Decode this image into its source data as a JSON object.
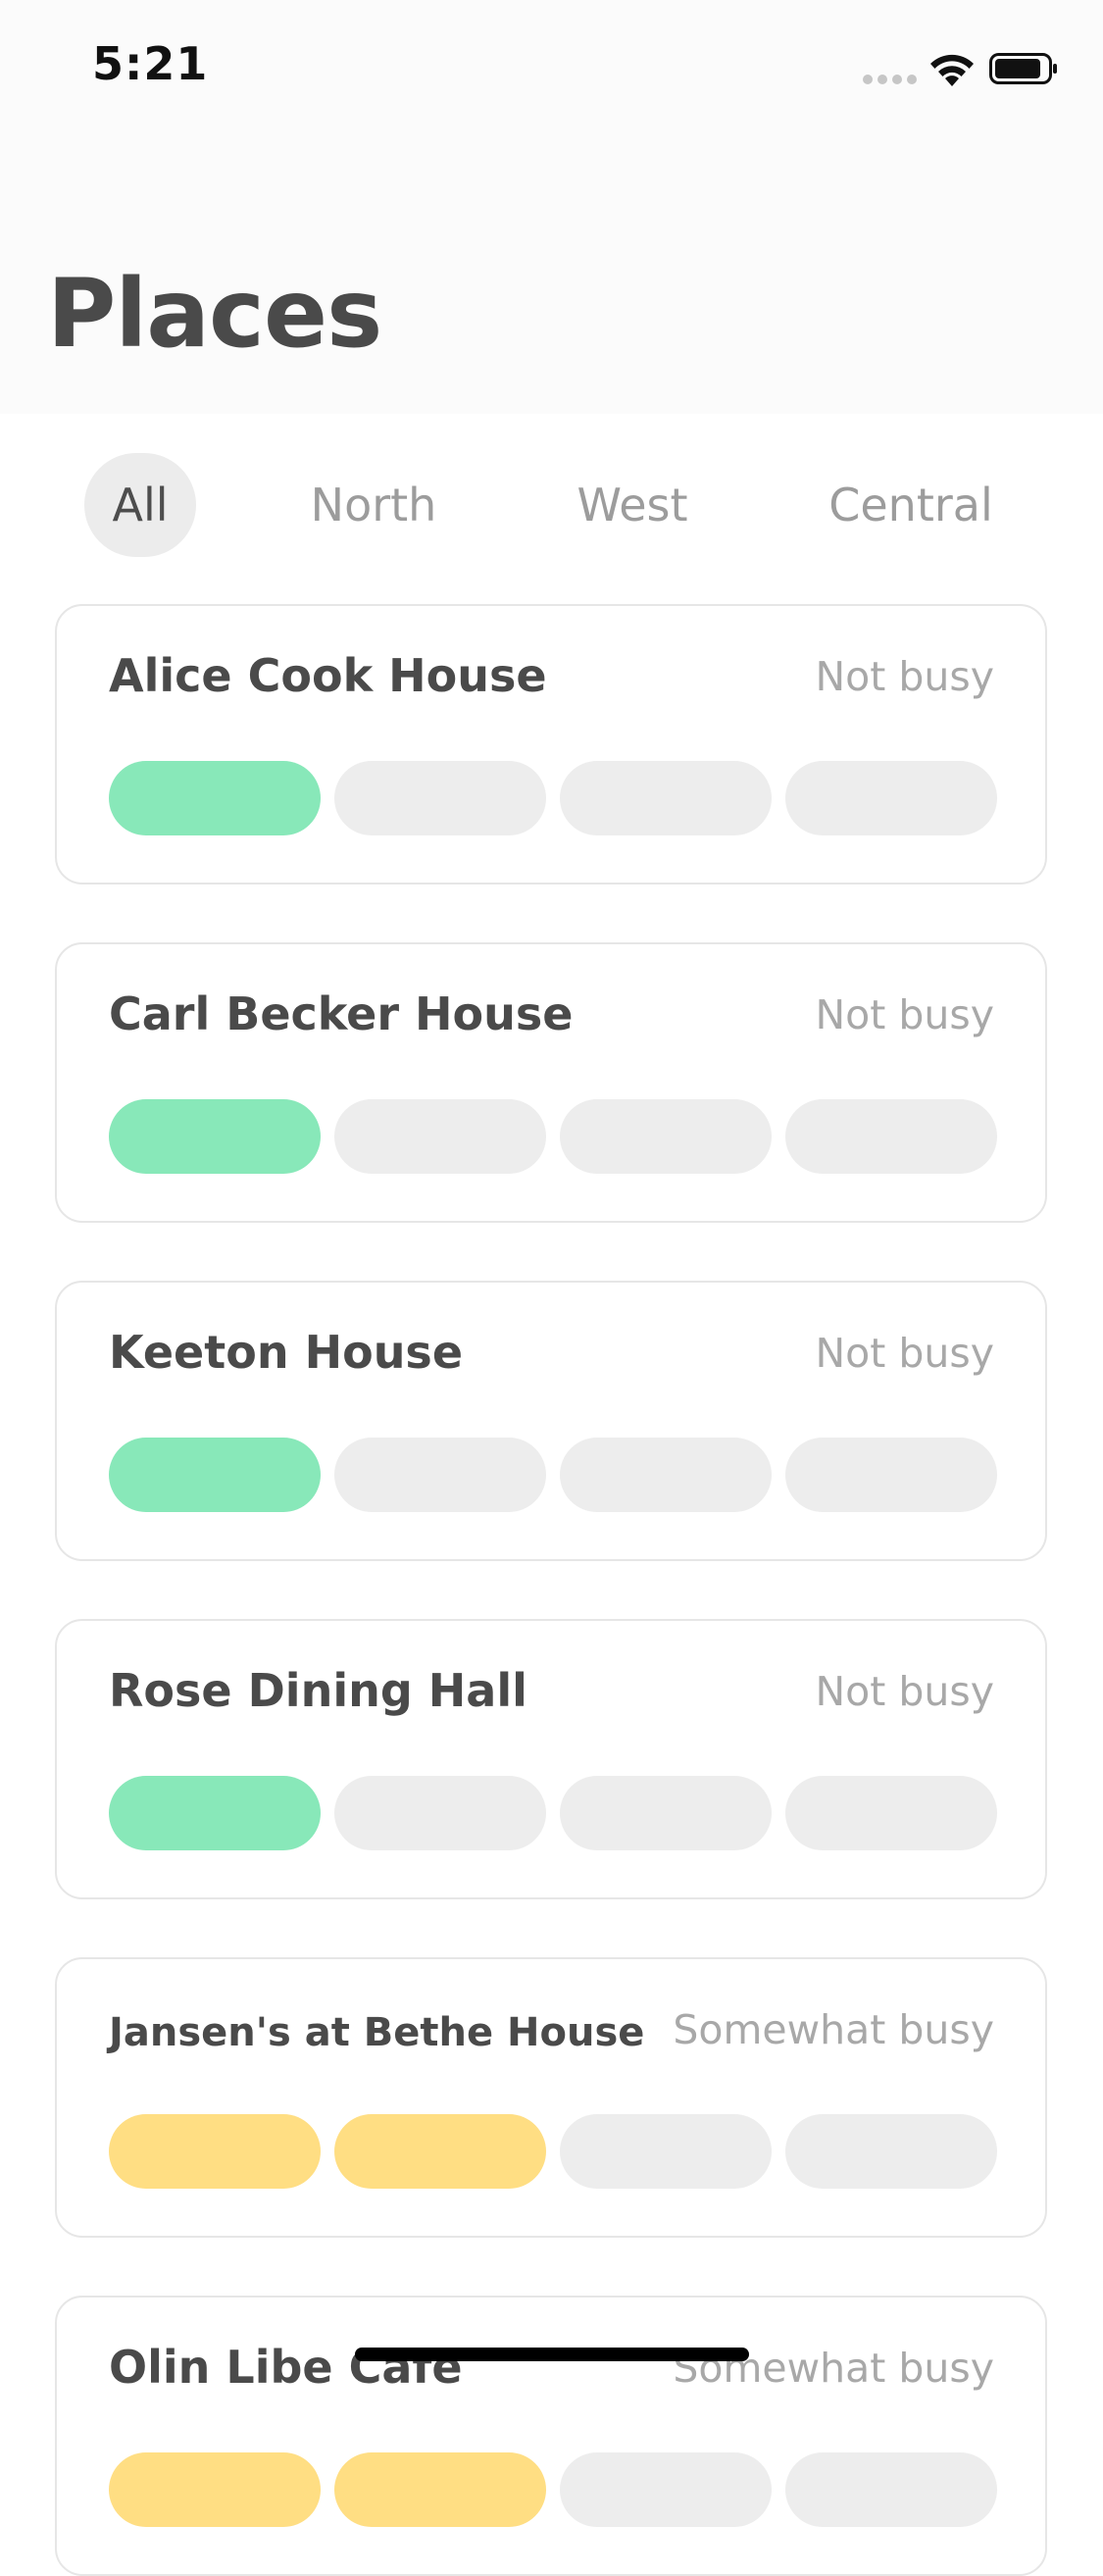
{
  "status_bar": {
    "time": "5:21"
  },
  "header": {
    "title": "Places"
  },
  "tabs": [
    {
      "label": "All",
      "active": true
    },
    {
      "label": "North",
      "active": false
    },
    {
      "label": "West",
      "active": false
    },
    {
      "label": "Central",
      "active": false
    }
  ],
  "colors": {
    "not_busy": "#88e8b9",
    "somewhat_busy": "#ffde83",
    "empty_segment": "#ededed"
  },
  "places": [
    {
      "name": "Alice Cook House",
      "status": "Not busy",
      "level": 1,
      "max_level": 4
    },
    {
      "name": "Carl Becker House",
      "status": "Not busy",
      "level": 1,
      "max_level": 4
    },
    {
      "name": "Keeton House",
      "status": "Not busy",
      "level": 1,
      "max_level": 4
    },
    {
      "name": "Rose Dining Hall",
      "status": "Not busy",
      "level": 1,
      "max_level": 4
    },
    {
      "name": "Jansen's at Bethe House",
      "status": "Somewhat busy",
      "level": 2,
      "max_level": 4
    },
    {
      "name": "Olin Libe Cafe",
      "status": "Somewhat busy",
      "level": 2,
      "max_level": 4
    }
  ]
}
